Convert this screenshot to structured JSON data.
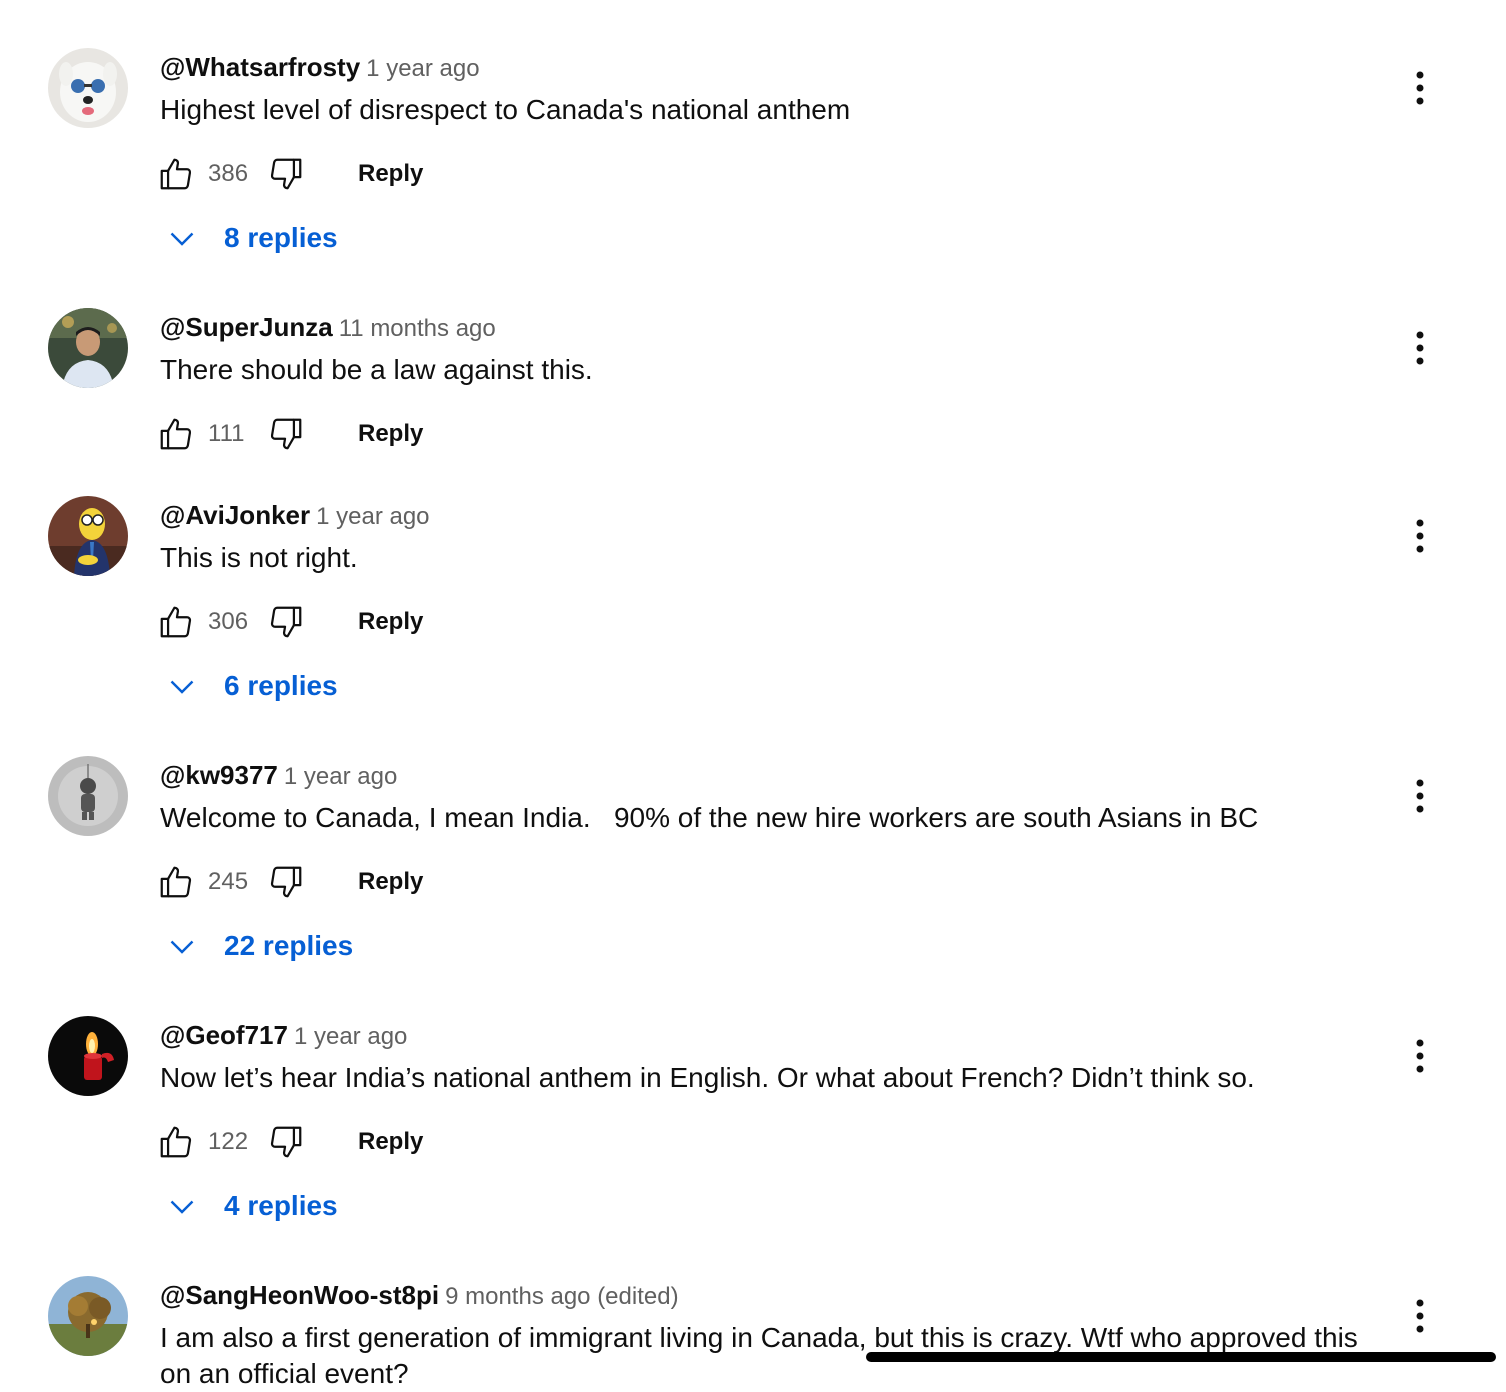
{
  "comments": [
    {
      "author": "@Whatsarfrosty",
      "time": "1 year ago",
      "text": "Highest level of disrespect to Canada's national anthem",
      "likes": "386",
      "reply_label": "Reply",
      "replies_label": "8 replies"
    },
    {
      "author": "@SuperJunza",
      "time": "11 months ago",
      "text": "There should be a law against this.",
      "likes": "111",
      "reply_label": "Reply"
    },
    {
      "author": "@AviJonker",
      "time": "1 year ago",
      "text": "This is not right.",
      "likes": "306",
      "reply_label": "Reply",
      "replies_label": "6 replies"
    },
    {
      "author": "@kw9377",
      "time": "1 year ago",
      "text": "Welcome to Canada, I mean India.   90% of the new hire workers are south Asians in BC",
      "likes": "245",
      "reply_label": "Reply",
      "replies_label": "22 replies"
    },
    {
      "author": "@Geof717",
      "time": "1 year ago",
      "text": "Now let’s hear India’s national anthem in English. Or what about French? Didn’t think so.",
      "likes": "122",
      "reply_label": "Reply",
      "replies_label": "4 replies"
    },
    {
      "author": "@SangHeonWoo-st8pi",
      "time": "9 months ago (edited)",
      "text": "I am also a first generation of immigrant living in Canada, but this is crazy. Wtf who approved this",
      "text_line2": "on an official event?"
    }
  ],
  "icons": {
    "like": "thumbs-up-icon",
    "dislike": "thumbs-down-icon",
    "more": "more-vert-icon",
    "expand": "chevron-down-icon"
  },
  "colors": {
    "link_blue": "#065fd4",
    "secondary_text": "#606060",
    "primary_text": "#0f0f0f"
  }
}
